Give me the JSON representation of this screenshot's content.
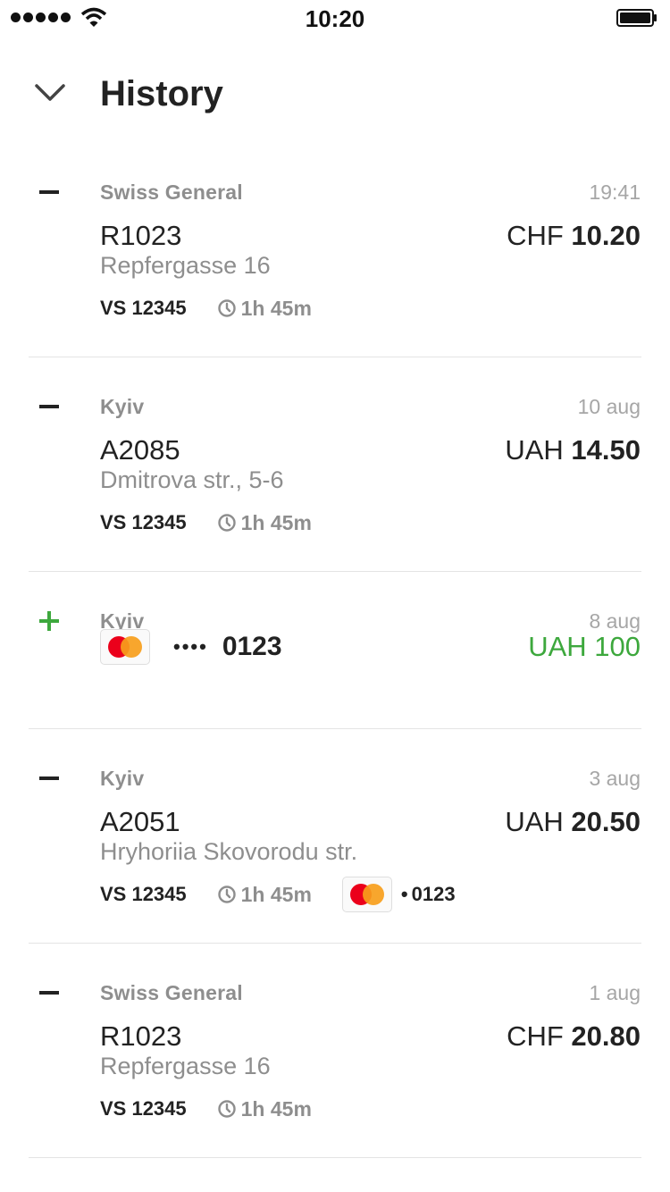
{
  "status_bar": {
    "time": "10:20"
  },
  "header": {
    "title": "History"
  },
  "history": [
    {
      "sign": "minus",
      "city": "Swiss General",
      "date": "19:41",
      "route": "R1023",
      "address": "Repfergasse 16",
      "currency": "CHF",
      "amount": "10.20",
      "vs": "VS 12345",
      "duration": "1h 45m"
    },
    {
      "sign": "minus",
      "city": "Kyiv",
      "date": "10 aug",
      "route": "A2085",
      "address": "Dmitrova str., 5-6",
      "currency": "UAH",
      "amount": "14.50",
      "vs": "VS 12345",
      "duration": "1h 45m"
    },
    {
      "sign": "plus",
      "city": "Kyiv",
      "date": "8 aug",
      "card_dots": "••••",
      "card_last4": "0123",
      "currency": "UAH",
      "amount": "100"
    },
    {
      "sign": "minus",
      "city": "Kyiv",
      "date": "3 aug",
      "route": "A2051",
      "address": "Hryhoriia Skovorodu str.",
      "currency": "UAH",
      "amount": "20.50",
      "vs": "VS 12345",
      "duration": "1h 45m",
      "card_bullet": "•",
      "card_last4": "0123"
    },
    {
      "sign": "minus",
      "city": "Swiss General",
      "date": "1 aug",
      "route": "R1023",
      "address": "Repfergasse 16",
      "currency": "CHF",
      "amount": "20.80",
      "vs": "VS 12345",
      "duration": "1h 45m"
    }
  ],
  "colors": {
    "credit": "#3da83d",
    "muted": "#8e8e8e",
    "text": "#222222"
  },
  "icons": {
    "back": "chevron-down-icon",
    "clock": "clock-icon",
    "card": "mastercard-icon"
  }
}
